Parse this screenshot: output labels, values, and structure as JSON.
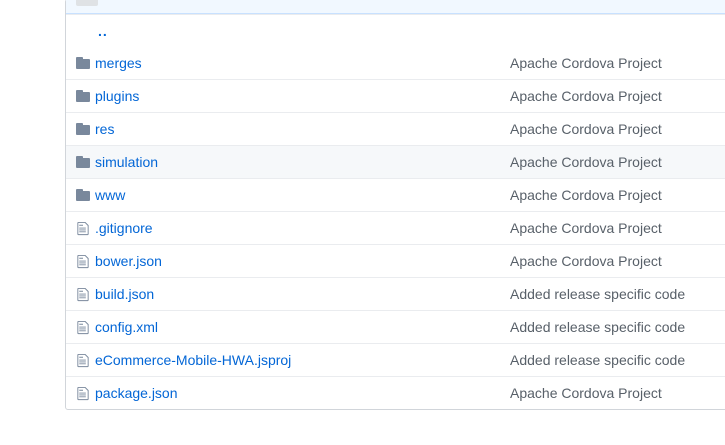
{
  "file_browser": {
    "parent_link": "..",
    "rows": [
      {
        "name": "merges",
        "type": "folder",
        "message": "Apache Cordova Project"
      },
      {
        "name": "plugins",
        "type": "folder",
        "message": "Apache Cordova Project"
      },
      {
        "name": "res",
        "type": "folder",
        "message": "Apache Cordova Project"
      },
      {
        "name": "simulation",
        "type": "folder",
        "message": "Apache Cordova Project"
      },
      {
        "name": "www",
        "type": "folder",
        "message": "Apache Cordova Project"
      },
      {
        "name": ".gitignore",
        "type": "file",
        "message": "Apache Cordova Project"
      },
      {
        "name": "bower.json",
        "type": "file",
        "message": "Apache Cordova Project"
      },
      {
        "name": "build.json",
        "type": "file",
        "message": "Added release specific code"
      },
      {
        "name": "config.xml",
        "type": "file",
        "message": "Added release specific code"
      },
      {
        "name": "eCommerce-Mobile-HWA.jsproj",
        "type": "file",
        "message": "Added release specific code"
      },
      {
        "name": "package.json",
        "type": "file",
        "message": "Apache Cordova Project"
      }
    ]
  },
  "icons": {
    "folder": "folder-icon",
    "file": "file-icon"
  },
  "colors": {
    "link": "#0366d6",
    "message": "#586069",
    "icon": "#79889c",
    "header_bg": "#f1f8ff",
    "hover_bg": "#f6f8fa",
    "border": "#eaecef"
  }
}
